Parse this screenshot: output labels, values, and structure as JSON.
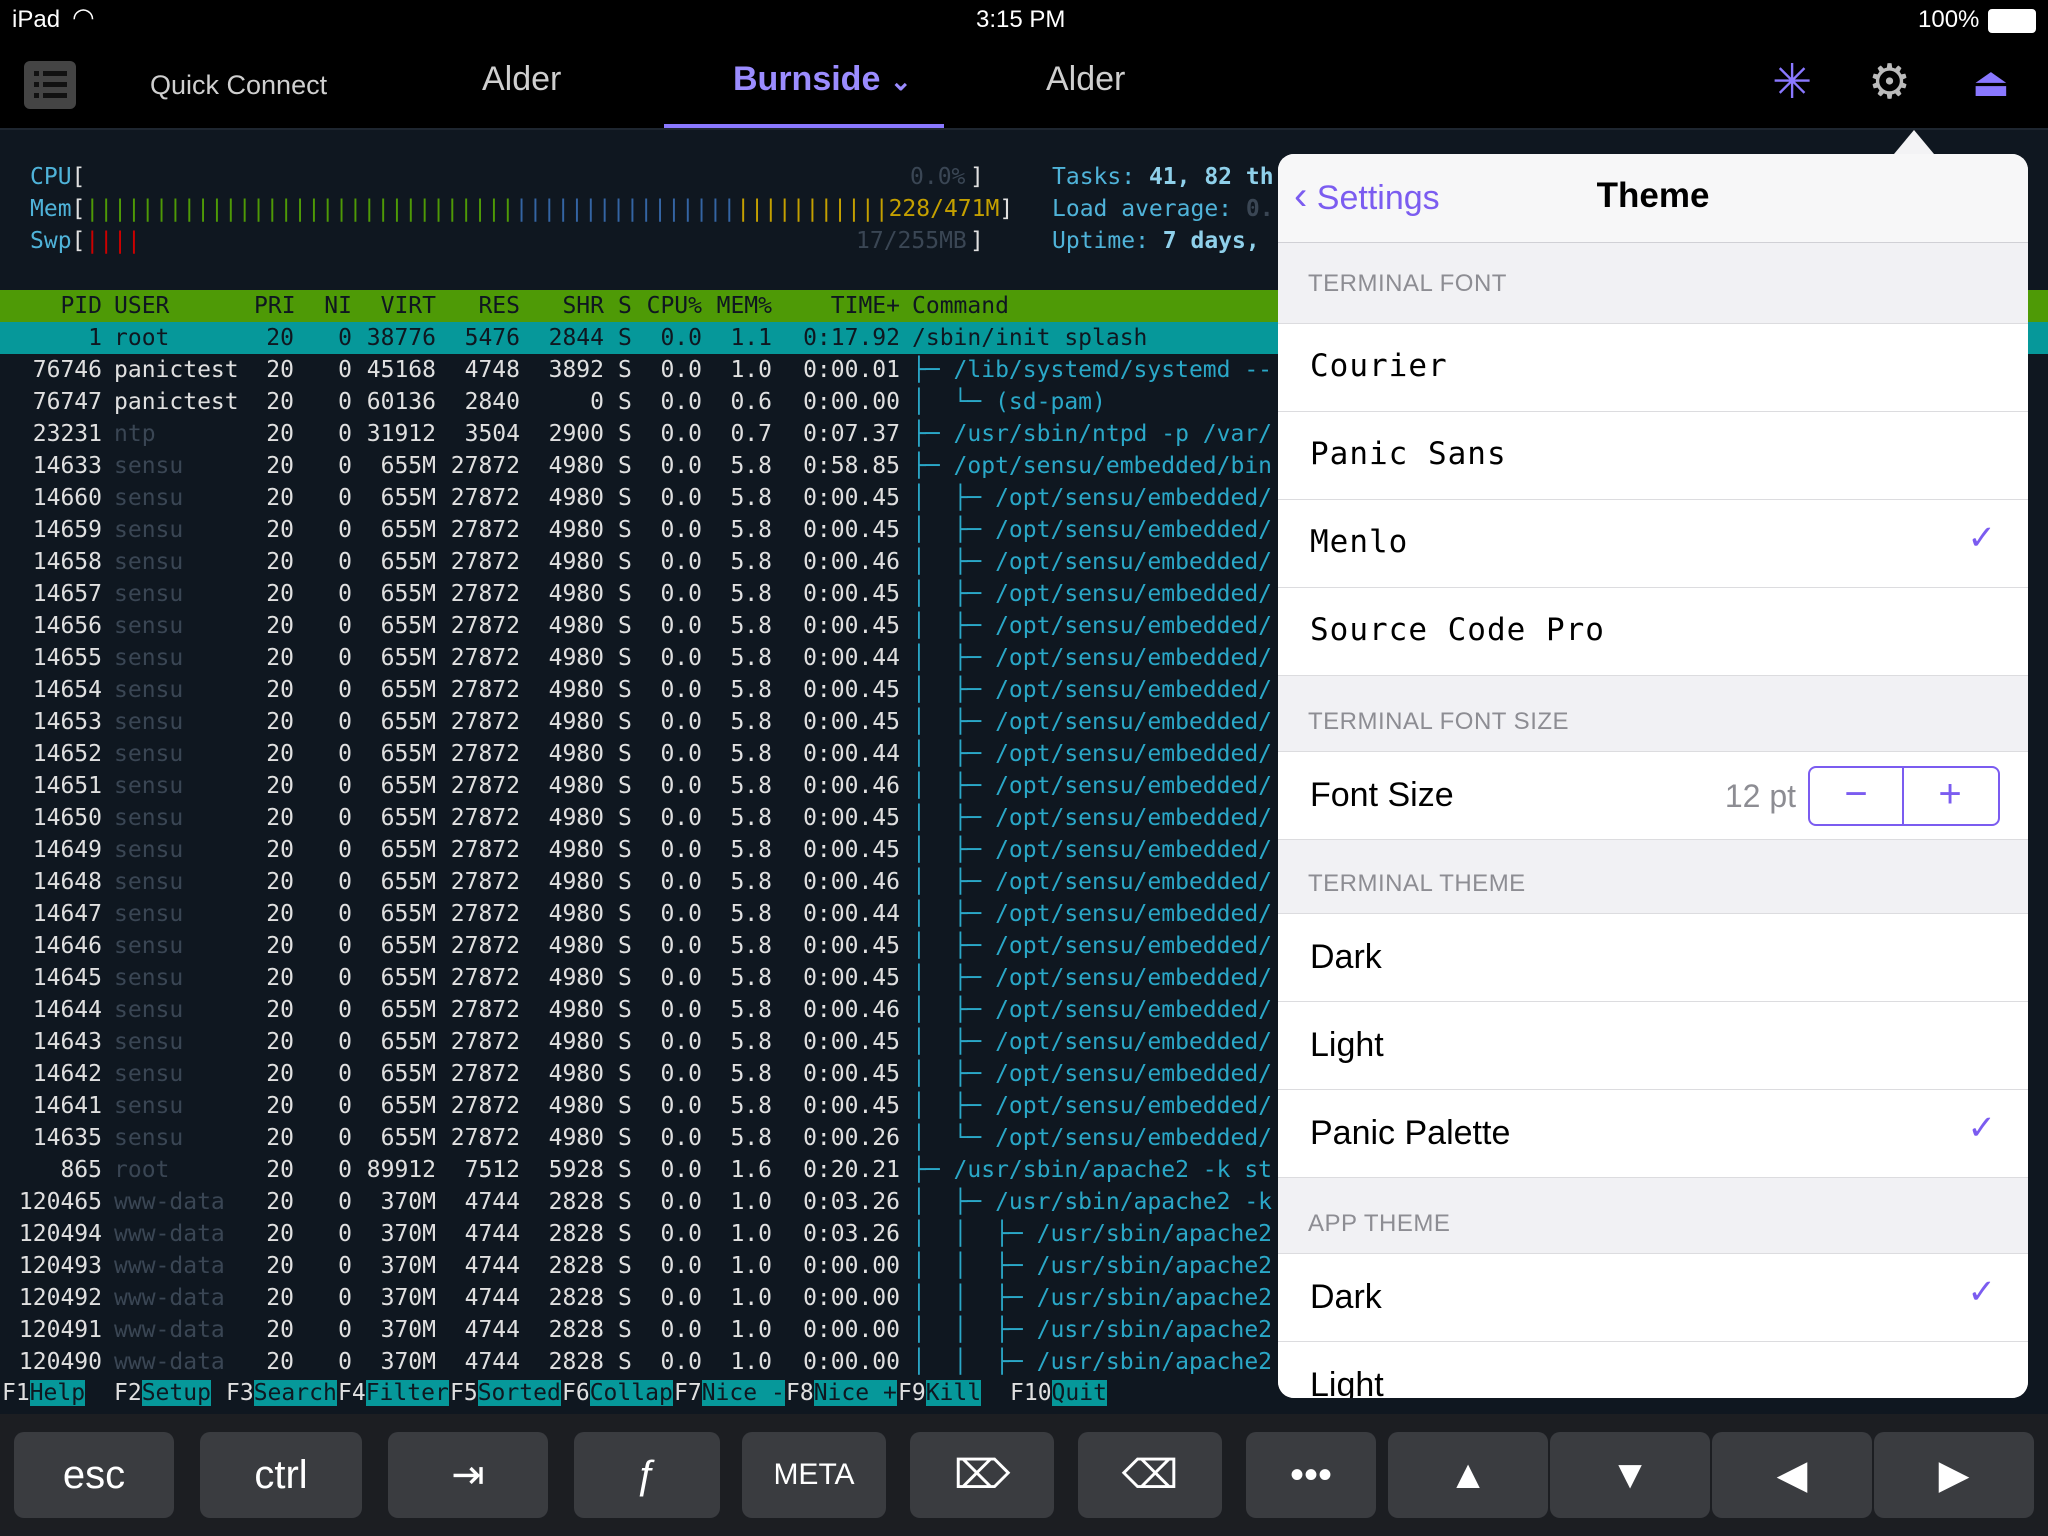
{
  "status": {
    "device": "iPad",
    "time": "3:15 PM",
    "battery": "100%"
  },
  "tabs": [
    {
      "label": "Quick Connect"
    },
    {
      "label": "Alder"
    },
    {
      "label": "Burnside"
    },
    {
      "label": "Alder"
    }
  ],
  "meters": {
    "cpu_label": "CPU",
    "cpu_value": "0.0%",
    "mem_label": "Mem",
    "mem_value": "228/471M",
    "swp_label": "Swp",
    "swp_value": "17/255MB",
    "tasks": "41, 82 th",
    "load": "0.",
    "uptime": "7 days,"
  },
  "table": {
    "headers": [
      "PID",
      "USER",
      "PRI",
      "NI",
      "VIRT",
      "RES",
      "SHR",
      "S",
      "CPU%",
      "MEM%",
      "TIME+",
      "Command"
    ],
    "rows": [
      [
        "1",
        "root",
        "20",
        "0",
        "38776",
        "5476",
        "2844",
        "S",
        "0.0",
        "1.1",
        "0:17.92",
        "/sbin/init splash"
      ],
      [
        "76746",
        "panictest",
        "20",
        "0",
        "45168",
        "4748",
        "3892",
        "S",
        "0.0",
        "1.0",
        "0:00.01",
        "├─ /lib/systemd/systemd --"
      ],
      [
        "76747",
        "panictest",
        "20",
        "0",
        "60136",
        "2840",
        "0",
        "S",
        "0.0",
        "0.6",
        "0:00.00",
        "│  └─ (sd-pam)"
      ],
      [
        "23231",
        "ntp",
        "20",
        "0",
        "31912",
        "3504",
        "2900",
        "S",
        "0.0",
        "0.7",
        "0:07.37",
        "├─ /usr/sbin/ntpd -p /var/"
      ],
      [
        "14633",
        "sensu",
        "20",
        "0",
        "655M",
        "27872",
        "4980",
        "S",
        "0.0",
        "5.8",
        "0:58.85",
        "├─ /opt/sensu/embedded/bin"
      ],
      [
        "14660",
        "sensu",
        "20",
        "0",
        "655M",
        "27872",
        "4980",
        "S",
        "0.0",
        "5.8",
        "0:00.45",
        "│  ├─ /opt/sensu/embedded/"
      ],
      [
        "14659",
        "sensu",
        "20",
        "0",
        "655M",
        "27872",
        "4980",
        "S",
        "0.0",
        "5.8",
        "0:00.45",
        "│  ├─ /opt/sensu/embedded/"
      ],
      [
        "14658",
        "sensu",
        "20",
        "0",
        "655M",
        "27872",
        "4980",
        "S",
        "0.0",
        "5.8",
        "0:00.46",
        "│  ├─ /opt/sensu/embedded/"
      ],
      [
        "14657",
        "sensu",
        "20",
        "0",
        "655M",
        "27872",
        "4980",
        "S",
        "0.0",
        "5.8",
        "0:00.45",
        "│  ├─ /opt/sensu/embedded/"
      ],
      [
        "14656",
        "sensu",
        "20",
        "0",
        "655M",
        "27872",
        "4980",
        "S",
        "0.0",
        "5.8",
        "0:00.45",
        "│  ├─ /opt/sensu/embedded/"
      ],
      [
        "14655",
        "sensu",
        "20",
        "0",
        "655M",
        "27872",
        "4980",
        "S",
        "0.0",
        "5.8",
        "0:00.44",
        "│  ├─ /opt/sensu/embedded/"
      ],
      [
        "14654",
        "sensu",
        "20",
        "0",
        "655M",
        "27872",
        "4980",
        "S",
        "0.0",
        "5.8",
        "0:00.45",
        "│  ├─ /opt/sensu/embedded/"
      ],
      [
        "14653",
        "sensu",
        "20",
        "0",
        "655M",
        "27872",
        "4980",
        "S",
        "0.0",
        "5.8",
        "0:00.45",
        "│  ├─ /opt/sensu/embedded/"
      ],
      [
        "14652",
        "sensu",
        "20",
        "0",
        "655M",
        "27872",
        "4980",
        "S",
        "0.0",
        "5.8",
        "0:00.44",
        "│  ├─ /opt/sensu/embedded/"
      ],
      [
        "14651",
        "sensu",
        "20",
        "0",
        "655M",
        "27872",
        "4980",
        "S",
        "0.0",
        "5.8",
        "0:00.46",
        "│  ├─ /opt/sensu/embedded/"
      ],
      [
        "14650",
        "sensu",
        "20",
        "0",
        "655M",
        "27872",
        "4980",
        "S",
        "0.0",
        "5.8",
        "0:00.45",
        "│  ├─ /opt/sensu/embedded/"
      ],
      [
        "14649",
        "sensu",
        "20",
        "0",
        "655M",
        "27872",
        "4980",
        "S",
        "0.0",
        "5.8",
        "0:00.45",
        "│  ├─ /opt/sensu/embedded/"
      ],
      [
        "14648",
        "sensu",
        "20",
        "0",
        "655M",
        "27872",
        "4980",
        "S",
        "0.0",
        "5.8",
        "0:00.46",
        "│  ├─ /opt/sensu/embedded/"
      ],
      [
        "14647",
        "sensu",
        "20",
        "0",
        "655M",
        "27872",
        "4980",
        "S",
        "0.0",
        "5.8",
        "0:00.44",
        "│  ├─ /opt/sensu/embedded/"
      ],
      [
        "14646",
        "sensu",
        "20",
        "0",
        "655M",
        "27872",
        "4980",
        "S",
        "0.0",
        "5.8",
        "0:00.45",
        "│  ├─ /opt/sensu/embedded/"
      ],
      [
        "14645",
        "sensu",
        "20",
        "0",
        "655M",
        "27872",
        "4980",
        "S",
        "0.0",
        "5.8",
        "0:00.45",
        "│  ├─ /opt/sensu/embedded/"
      ],
      [
        "14644",
        "sensu",
        "20",
        "0",
        "655M",
        "27872",
        "4980",
        "S",
        "0.0",
        "5.8",
        "0:00.46",
        "│  ├─ /opt/sensu/embedded/"
      ],
      [
        "14643",
        "sensu",
        "20",
        "0",
        "655M",
        "27872",
        "4980",
        "S",
        "0.0",
        "5.8",
        "0:00.45",
        "│  ├─ /opt/sensu/embedded/"
      ],
      [
        "14642",
        "sensu",
        "20",
        "0",
        "655M",
        "27872",
        "4980",
        "S",
        "0.0",
        "5.8",
        "0:00.45",
        "│  ├─ /opt/sensu/embedded/"
      ],
      [
        "14641",
        "sensu",
        "20",
        "0",
        "655M",
        "27872",
        "4980",
        "S",
        "0.0",
        "5.8",
        "0:00.45",
        "│  ├─ /opt/sensu/embedded/"
      ],
      [
        "14635",
        "sensu",
        "20",
        "0",
        "655M",
        "27872",
        "4980",
        "S",
        "0.0",
        "5.8",
        "0:00.26",
        "│  └─ /opt/sensu/embedded/"
      ],
      [
        "865",
        "root",
        "20",
        "0",
        "89912",
        "7512",
        "5928",
        "S",
        "0.0",
        "1.6",
        "0:20.21",
        "├─ /usr/sbin/apache2 -k st"
      ],
      [
        "120465",
        "www-data",
        "20",
        "0",
        "370M",
        "4744",
        "2828",
        "S",
        "0.0",
        "1.0",
        "0:03.26",
        "│  ├─ /usr/sbin/apache2 -k"
      ],
      [
        "120494",
        "www-data",
        "20",
        "0",
        "370M",
        "4744",
        "2828",
        "S",
        "0.0",
        "1.0",
        "0:03.26",
        "│  │  ├─ /usr/sbin/apache2"
      ],
      [
        "120493",
        "www-data",
        "20",
        "0",
        "370M",
        "4744",
        "2828",
        "S",
        "0.0",
        "1.0",
        "0:00.00",
        "│  │  ├─ /usr/sbin/apache2"
      ],
      [
        "120492",
        "www-data",
        "20",
        "0",
        "370M",
        "4744",
        "2828",
        "S",
        "0.0",
        "1.0",
        "0:00.00",
        "│  │  ├─ /usr/sbin/apache2"
      ],
      [
        "120491",
        "www-data",
        "20",
        "0",
        "370M",
        "4744",
        "2828",
        "S",
        "0.0",
        "1.0",
        "0:00.00",
        "│  │  ├─ /usr/sbin/apache2"
      ],
      [
        "120490",
        "www-data",
        "20",
        "0",
        "370M",
        "4744",
        "2828",
        "S",
        "0.0",
        "1.0",
        "0:00.00",
        "│  │  ├─ /usr/sbin/apache2"
      ]
    ]
  },
  "fkeys": [
    {
      "n": "F1",
      "l": "Help"
    },
    {
      "n": "F2",
      "l": "Setup"
    },
    {
      "n": "F3",
      "l": "Search"
    },
    {
      "n": "F4",
      "l": "Filter"
    },
    {
      "n": "F5",
      "l": "Sorted"
    },
    {
      "n": "F6",
      "l": "Collap"
    },
    {
      "n": "F7",
      "l": "Nice -"
    },
    {
      "n": "F8",
      "l": "Nice +"
    },
    {
      "n": "F9",
      "l": "Kill"
    },
    {
      "n": "F10",
      "l": "Quit"
    }
  ],
  "keyboard": [
    "esc",
    "ctrl",
    "⇥",
    "ƒ",
    "META",
    "⌦",
    "⌫",
    "•••",
    "▲",
    "▼",
    "◀",
    "▶"
  ],
  "popover": {
    "back_label": "Settings",
    "title": "Theme",
    "terminal_font_header": "TERMINAL FONT",
    "fonts": [
      "Courier",
      "Panic Sans",
      "Menlo",
      "Source Code Pro"
    ],
    "font_size_header": "TERMINAL FONT SIZE",
    "font_size_label": "Font Size",
    "font_size_value": "12 pt",
    "terminal_theme_header": "TERMINAL THEME",
    "terminal_themes": [
      "Dark",
      "Light",
      "Panic Palette"
    ],
    "app_theme_header": "APP THEME",
    "app_themes": [
      "Dark",
      "Light"
    ],
    "accent": "#7b5cf0"
  },
  "icons": {
    "menu": "list-icon",
    "activity": "spark-icon",
    "settings": "gear-icon",
    "eject": "eject-icon"
  }
}
